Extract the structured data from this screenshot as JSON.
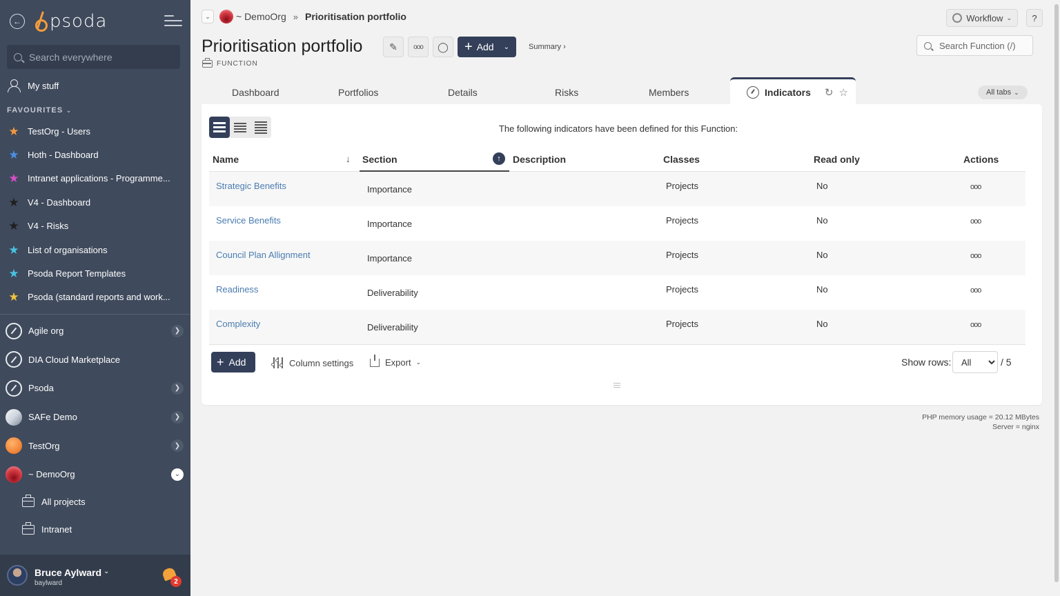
{
  "sidebar": {
    "logo": "psoda",
    "search_placeholder": "Search everywhere",
    "my_stuff": "My stuff",
    "favourites_heading": "FAVOURITES",
    "favourites": [
      {
        "label": "TestOrg - Users",
        "color": "#f39a3e"
      },
      {
        "label": "Hoth - Dashboard",
        "color": "#4a90e2"
      },
      {
        "label": "Intranet applications - Programme...",
        "color": "#d64fc8"
      },
      {
        "label": "V4 - Dashboard",
        "color": "#2c2c2c"
      },
      {
        "label": "V4 - Risks",
        "color": "#2c2c2c"
      },
      {
        "label": "List of organisations",
        "color": "#48c3e0"
      },
      {
        "label": "Psoda Report Templates",
        "color": "#48c3e0"
      },
      {
        "label": "Psoda (standard reports and work...",
        "color": "#f2c23b"
      }
    ],
    "orgs": [
      {
        "label": "Agile org",
        "has_chevron": true
      },
      {
        "label": "DIA Cloud Marketplace",
        "has_chevron": false
      },
      {
        "label": "Psoda",
        "has_chevron": true
      },
      {
        "label": "SAFe Demo",
        "has_chevron": true
      },
      {
        "label": "TestOrg",
        "has_chevron": true
      },
      {
        "label": "~ DemoOrg",
        "has_chevron": true,
        "expanded": true
      }
    ],
    "sub_items": [
      {
        "label": "All projects"
      },
      {
        "label": "Intranet"
      }
    ],
    "user": {
      "name": "Bruce Aylward",
      "username": "baylward",
      "notifications": "2"
    }
  },
  "breadcrumb": {
    "org": "~ DemoOrg",
    "separator": "»",
    "current": "Prioritisation portfolio"
  },
  "top_right": {
    "workflow": "Workflow",
    "help": "?"
  },
  "page": {
    "title": "Prioritisation portfolio",
    "type": "FUNCTION",
    "add_label": "Add",
    "summary_link": "Summary ›",
    "search_placeholder": "Search Function (/)"
  },
  "tabs": [
    {
      "label": "Dashboard"
    },
    {
      "label": "Portfolios"
    },
    {
      "label": "Details"
    },
    {
      "label": "Risks"
    },
    {
      "label": "Members"
    }
  ],
  "active_tab": "Indicators",
  "all_tabs": "All tabs",
  "indicators": {
    "intro": "The following indicators have been defined for this Function:",
    "columns": [
      "Name",
      "Section",
      "Description",
      "Classes",
      "Read only",
      "Actions"
    ],
    "rows": [
      {
        "name": "Strategic Benefits",
        "section": "Importance",
        "description": "",
        "classes": "Projects",
        "read_only": "No",
        "actions": "ooo"
      },
      {
        "name": "Service Benefits",
        "section": "Importance",
        "description": "",
        "classes": "Projects",
        "read_only": "No",
        "actions": "ooo"
      },
      {
        "name": "Council Plan Allignment",
        "section": "Importance",
        "description": "",
        "classes": "Projects",
        "read_only": "No",
        "actions": "ooo"
      },
      {
        "name": "Readiness",
        "section": "Deliverability",
        "description": "",
        "classes": "Projects",
        "read_only": "No",
        "actions": "ooo"
      },
      {
        "name": "Complexity",
        "section": "Deliverability",
        "description": "",
        "classes": "Projects",
        "read_only": "No",
        "actions": "ooo"
      }
    ],
    "add_label": "Add",
    "column_settings": "Column settings",
    "export": "Export",
    "show_rows_label": "Show rows:",
    "show_rows_value": "All",
    "total": "/ 5"
  },
  "footer": {
    "memory": "PHP memory usage = 20.12 MBytes",
    "server": "Server = nginx"
  }
}
